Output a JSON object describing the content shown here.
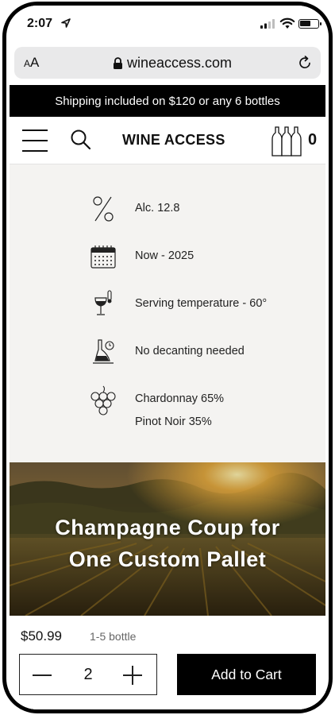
{
  "status_bar": {
    "time": "2:07"
  },
  "browser": {
    "text_size_small": "A",
    "text_size_large": "A",
    "url": "wineaccess.com"
  },
  "banner": {
    "text": "Shipping included on $120 or any 6 bottles"
  },
  "header": {
    "brand": "WINE ACCESS",
    "cart_count": "0"
  },
  "details": [
    {
      "icon": "percent-icon",
      "text": "Alc. 12.8"
    },
    {
      "icon": "calendar-icon",
      "text": "Now - 2025"
    },
    {
      "icon": "wine-thermometer-icon",
      "text": "Serving temperature - 60°"
    },
    {
      "icon": "decanter-icon",
      "text": "No decanting needed"
    },
    {
      "icon": "grapes-icon",
      "text": "Chardonnay 65%",
      "text2": "Pinot Noir 35%"
    }
  ],
  "hero": {
    "line1": "Champagne Coup for",
    "line2": "One Custom Pallet"
  },
  "purchase": {
    "price": "$50.99",
    "range": "1-5 bottle",
    "quantity": "2",
    "add_to_cart": "Add to Cart"
  },
  "colors": {
    "banner_bg": "#000000",
    "details_bg": "#f4f3f1",
    "cta_bg": "#000000"
  }
}
